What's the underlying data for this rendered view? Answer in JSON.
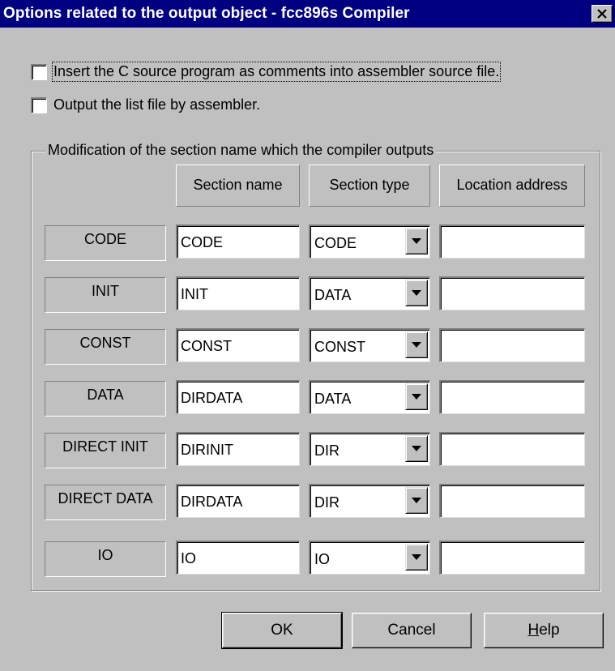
{
  "window": {
    "title": "Options related to the output object - fcc896s Compiler",
    "close_icon": "close-icon"
  },
  "options": [
    {
      "label": "Insert the C source program as comments into assembler source file.",
      "checked": false
    },
    {
      "label": "Output the list file by assembler.",
      "checked": false
    }
  ],
  "group": {
    "title": "Modification of the section name which the compiler outputs",
    "headers": {
      "section_name": "Section name",
      "section_type": "Section type",
      "location_address": "Location address"
    },
    "rows": [
      {
        "label": "CODE",
        "section_name": "CODE",
        "section_type": "CODE",
        "location_address": ""
      },
      {
        "label": "INIT",
        "section_name": "INIT",
        "section_type": "DATA",
        "location_address": ""
      },
      {
        "label": "CONST",
        "section_name": "CONST",
        "section_type": "CONST",
        "location_address": ""
      },
      {
        "label": "DATA",
        "section_name": "DIRDATA",
        "section_type": "DATA",
        "location_address": ""
      },
      {
        "label": "DIRECT INIT",
        "section_name": "DIRINIT",
        "section_type": "DIR",
        "location_address": ""
      },
      {
        "label": "DIRECT DATA",
        "section_name": "DIRDATA",
        "section_type": "DIR",
        "location_address": ""
      },
      {
        "label": "IO",
        "section_name": "IO",
        "section_type": "IO",
        "location_address": ""
      }
    ]
  },
  "buttons": {
    "ok": "OK",
    "cancel": "Cancel",
    "help_mnemonic": "H",
    "help_rest": "elp"
  },
  "colors": {
    "titlebar": "#000080",
    "face": "#c0c0c0"
  }
}
